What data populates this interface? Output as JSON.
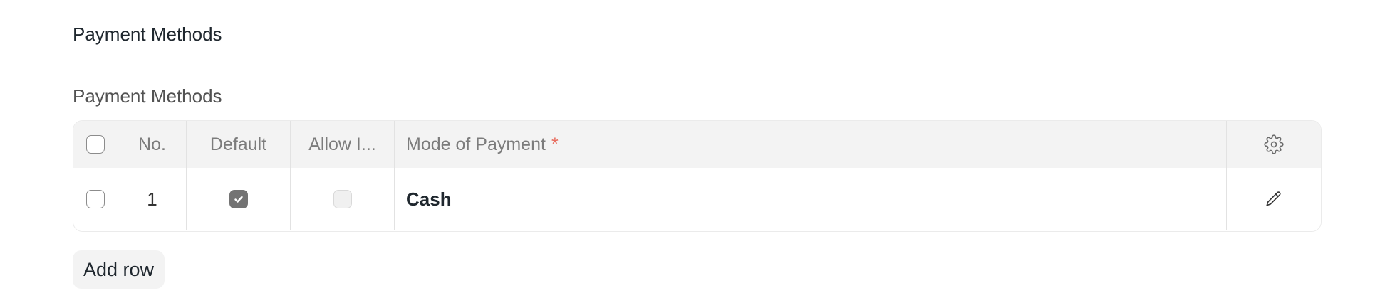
{
  "section": {
    "title": "Payment Methods"
  },
  "field": {
    "label": "Payment Methods"
  },
  "table": {
    "headers": {
      "no": "No.",
      "default": "Default",
      "allow": "Allow I...",
      "mode": "Mode of Payment",
      "required_marker": "*"
    },
    "rows": [
      {
        "no": "1",
        "default": true,
        "allow": false,
        "mode": "Cash"
      }
    ]
  },
  "actions": {
    "add_row_label": "Add row"
  },
  "icons": {
    "header_action": "gear-icon",
    "row_action": "pencil-icon",
    "checked_mark": "check-icon"
  },
  "colors": {
    "required": "#e86c5e",
    "checked_bg": "#737373",
    "header_bg": "#f3f3f3"
  }
}
